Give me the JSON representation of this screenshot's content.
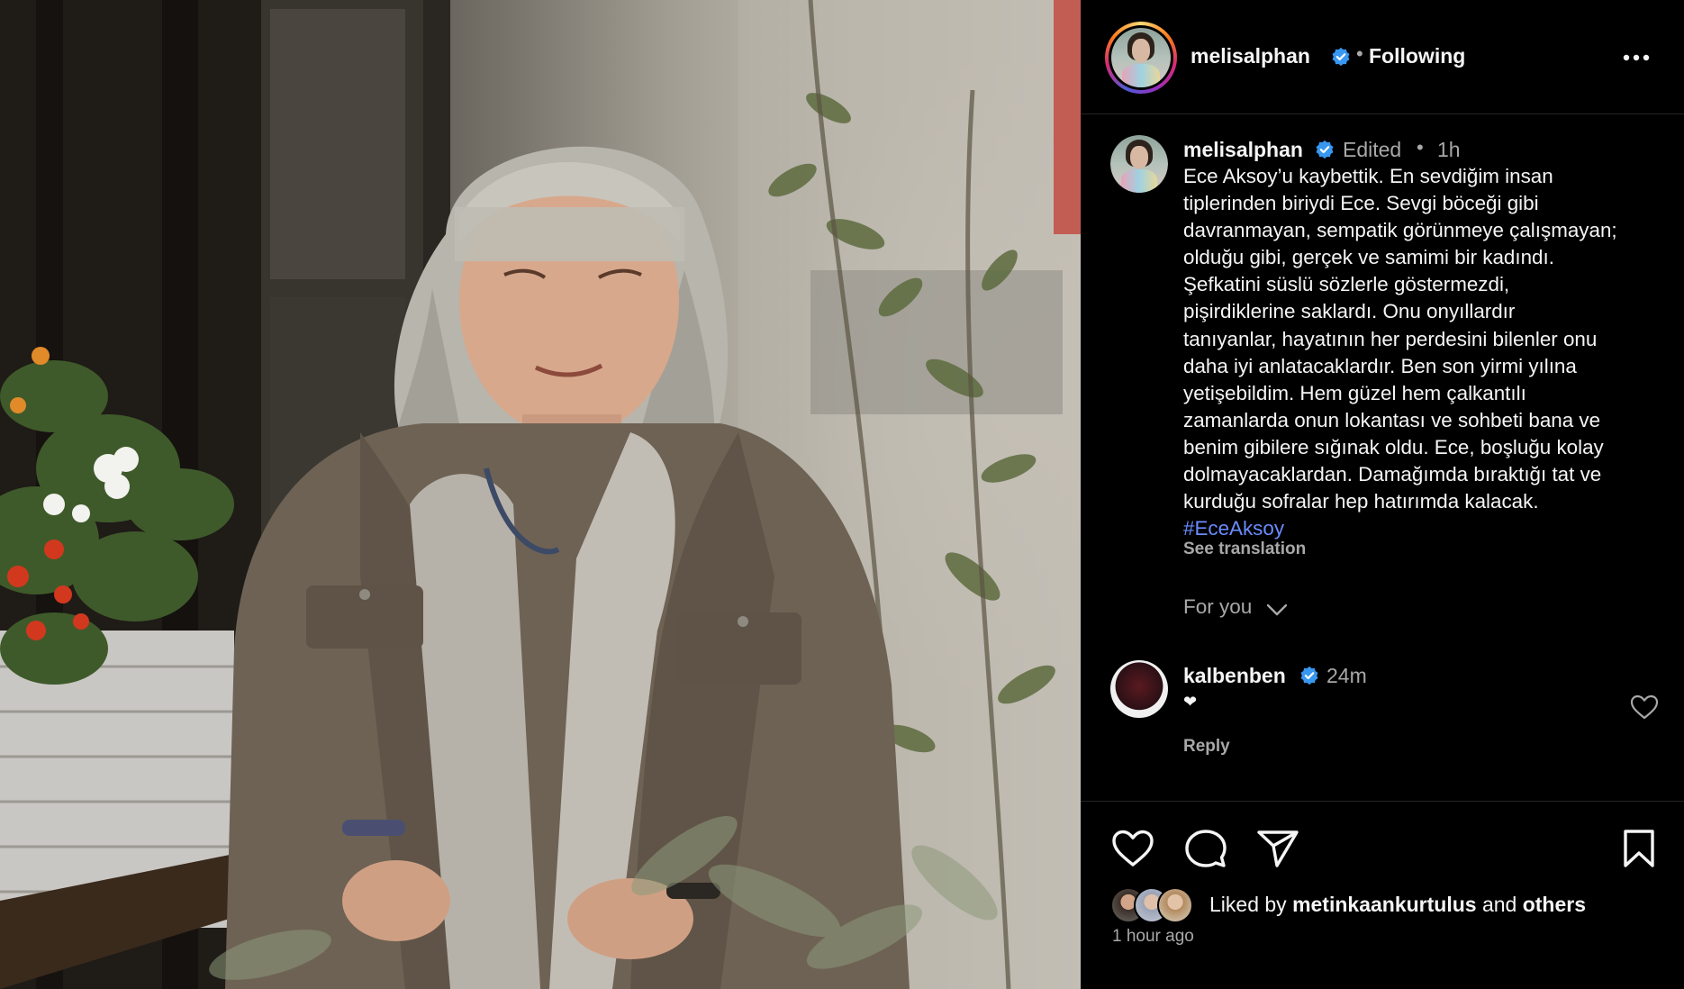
{
  "post": {
    "author": "melisalphan",
    "follow_status": "Following",
    "separator": "•",
    "verified_icon": "verified-badge-icon",
    "more_icon": "more-options-icon"
  },
  "caption": {
    "author": "melisalphan",
    "edited": "Edited",
    "separator": "•",
    "time": "1h",
    "lines": [
      "Ece Aksoy’u kaybettik. En sevdiğim insan",
      "tiplerinden biriydi Ece. Sevgi böceği gibi",
      "davranmayan, sempatik görünmeye çalışmayan;",
      "olduğu gibi, gerçek ve samimi bir kadındı.",
      "Şefkatini süslü sözlerle göstermezdi,",
      "pişirdiklerine saklardı. Onu onyıllardır",
      "tanıyanlar, hayatının her perdesini bilenler onu",
      "daha iyi anlatacaklardır. Ben son yirmi yılına",
      "yetişebildim. Hem güzel hem çalkantılı",
      "zamanlarda onun lokantası ve sohbeti bana ve",
      "benim gibilere sığınak oldu. Ece, boşluğu kolay",
      "dolmayacaklardan. Damağımda bıraktığı tat ve",
      "kurduğu sofralar hep hatırımda kalacak."
    ],
    "hashtag": "#EceAksoy",
    "see_translation": "See translation"
  },
  "comments_filter": {
    "label": "For you",
    "icon": "chevron-down-icon"
  },
  "comment": {
    "author": "kalbenben",
    "time": "24m",
    "text": "❤",
    "reply_label": "Reply",
    "like_icon": "heart-outline-icon"
  },
  "actions": {
    "like_icon": "heart-outline-icon",
    "comment_icon": "comment-icon",
    "share_icon": "send-icon",
    "save_icon": "bookmark-icon"
  },
  "likes": {
    "prefix": "Liked by",
    "user": "metinkaankurtulus",
    "conjunction": "and",
    "others": "others"
  },
  "timestamp": "1 hour ago",
  "colors": {
    "background": "#000000",
    "text": "#f5f5f5",
    "secondary_text": "#a8a8a8",
    "link": "#6b8cff",
    "verified": "#3897f0",
    "divider": "#262626"
  }
}
